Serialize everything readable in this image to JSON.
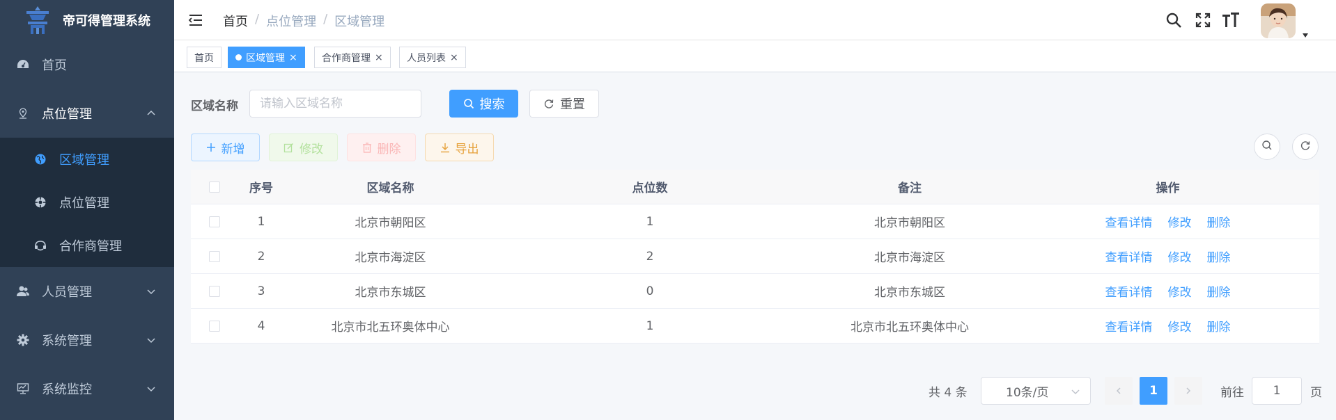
{
  "app": {
    "title": "帝可得管理系统"
  },
  "sidebar": {
    "items": [
      {
        "label": "首页"
      },
      {
        "label": "点位管理"
      },
      {
        "label": "人员管理"
      },
      {
        "label": "系统管理"
      },
      {
        "label": "系统监控"
      }
    ],
    "sub_items": [
      {
        "label": "区域管理"
      },
      {
        "label": "点位管理"
      },
      {
        "label": "合作商管理"
      }
    ]
  },
  "breadcrumb": [
    "首页",
    "点位管理",
    "区域管理"
  ],
  "tags": [
    {
      "label": "首页"
    },
    {
      "label": "区域管理"
    },
    {
      "label": "合作商管理"
    },
    {
      "label": "人员列表"
    }
  ],
  "search": {
    "label": "区域名称",
    "placeholder": "请输入区域名称",
    "search_btn": "搜索",
    "reset_btn": "重置"
  },
  "toolbar": {
    "add": "新增",
    "edit": "修改",
    "delete": "删除",
    "export": "导出"
  },
  "table": {
    "headers": [
      "序号",
      "区域名称",
      "点位数",
      "备注",
      "操作"
    ],
    "rows": [
      {
        "idx": "1",
        "name": "北京市朝阳区",
        "count": "1",
        "note": "北京市朝阳区"
      },
      {
        "idx": "2",
        "name": "北京市海淀区",
        "count": "2",
        "note": "北京市海淀区"
      },
      {
        "idx": "3",
        "name": "北京市东城区",
        "count": "0",
        "note": "北京市东城区"
      },
      {
        "idx": "4",
        "name": "北京市北五环奥体中心",
        "count": "1",
        "note": "北京市北五环奥体中心"
      }
    ],
    "ops": {
      "detail": "查看详情",
      "edit": "修改",
      "delete": "删除"
    }
  },
  "pagination": {
    "total": "共 4 条",
    "page_size": "10条/页",
    "current": "1",
    "goto_label": "前往",
    "goto_value": "1",
    "page_suffix": "页"
  },
  "colors": {
    "sidebar_bg": "#304156",
    "submenu_bg": "#1f2d3d",
    "primary": "#409eff"
  }
}
